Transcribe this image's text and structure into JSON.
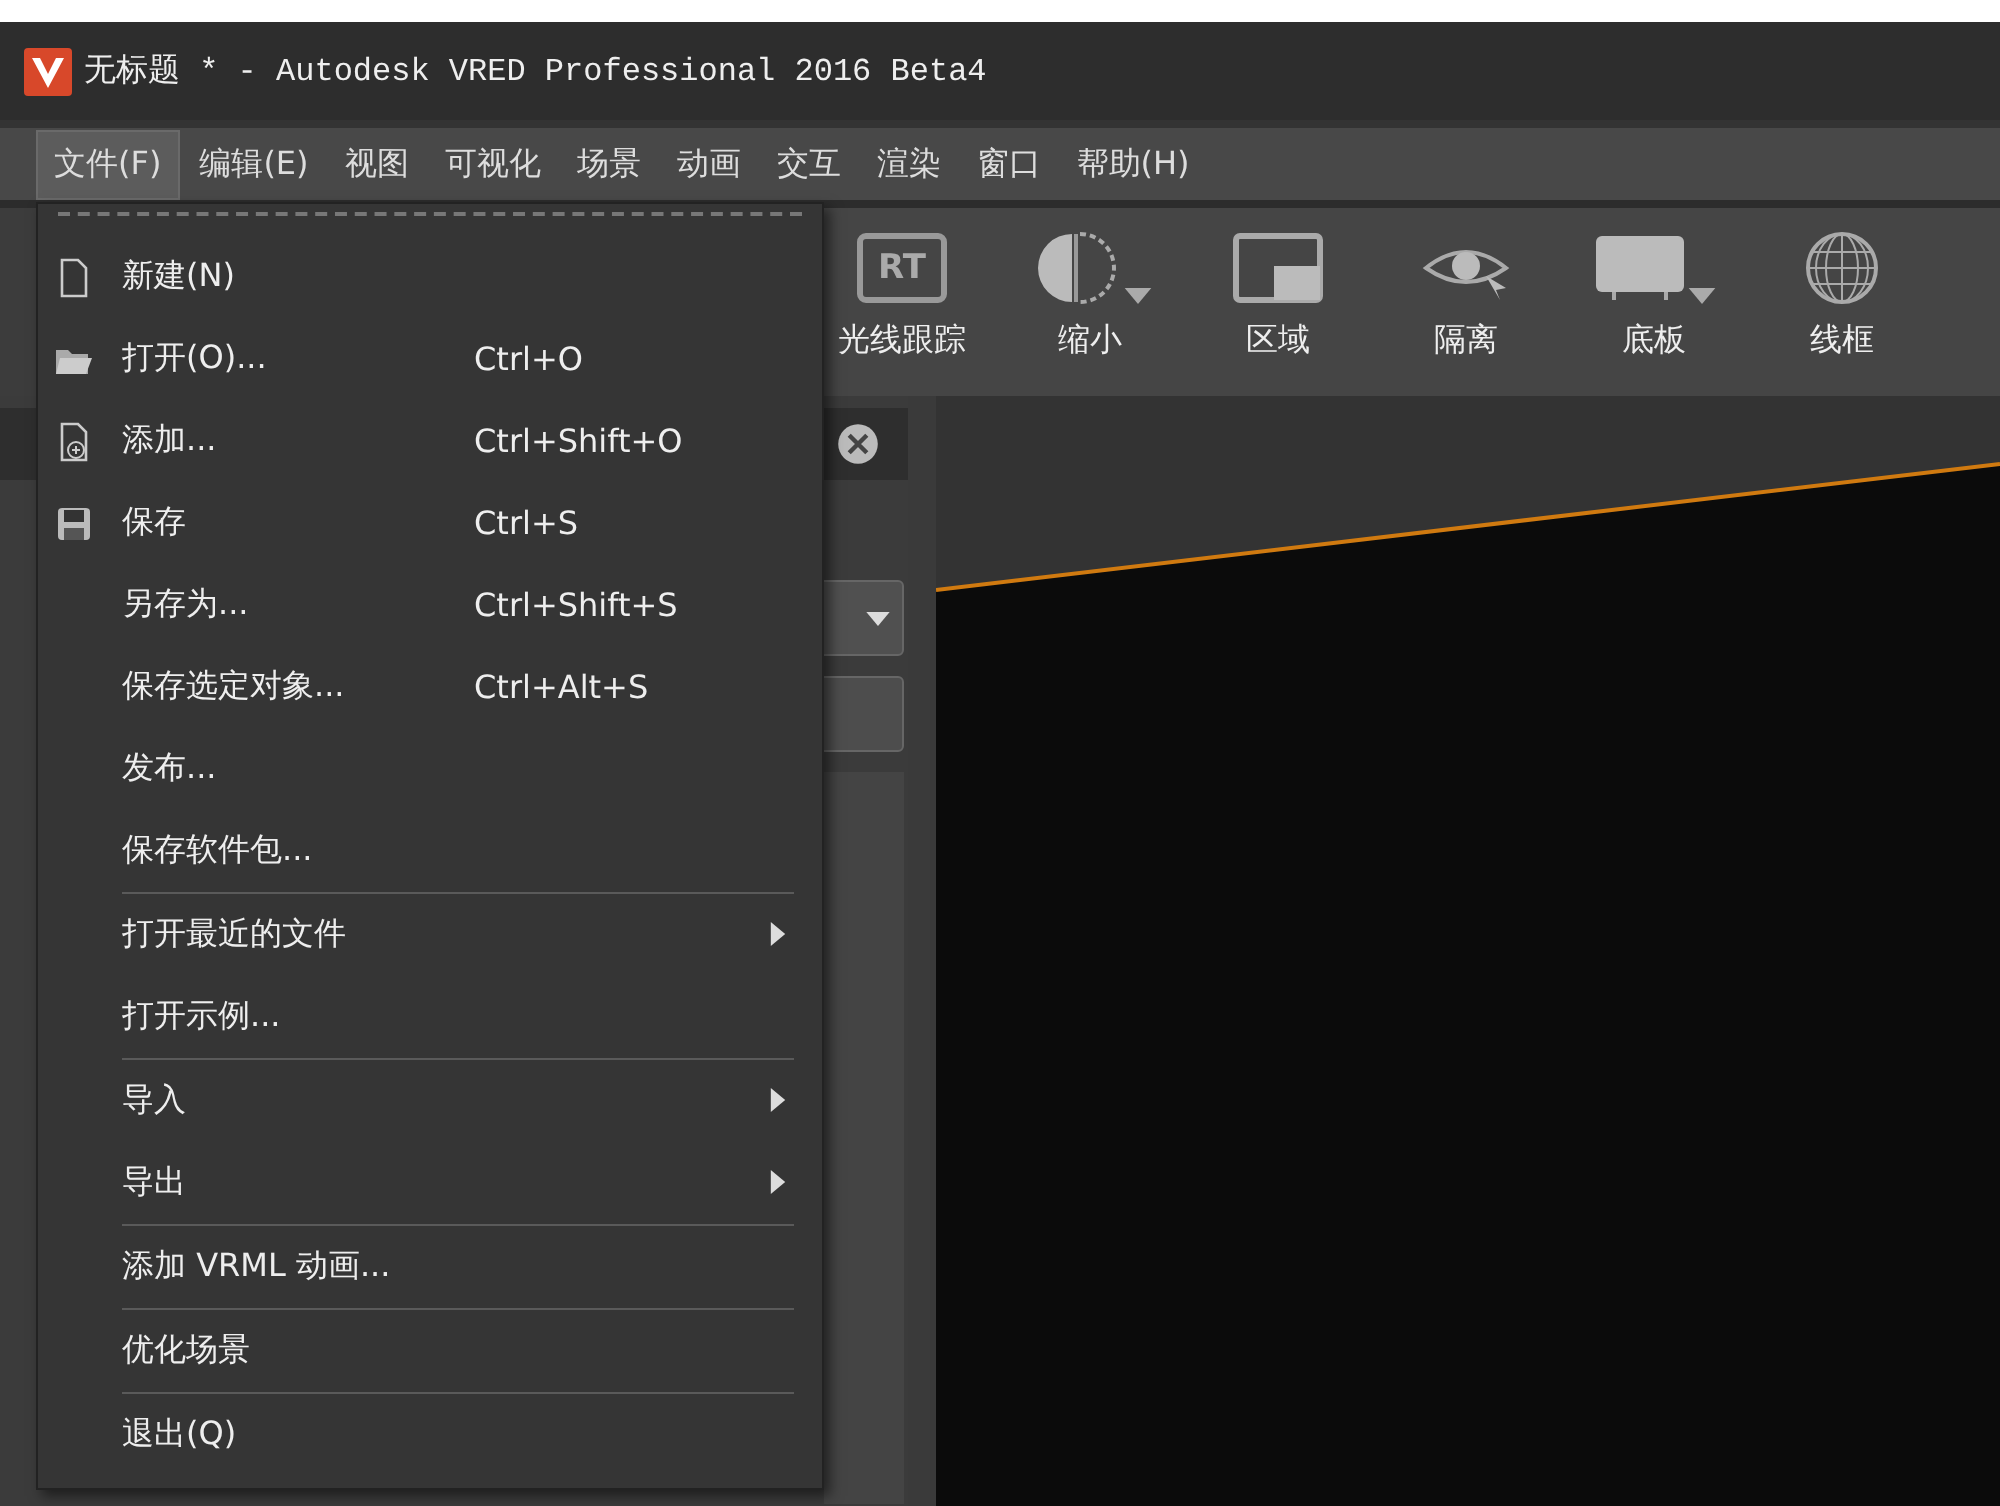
{
  "window": {
    "title": "无标题 * - Autodesk VRED Professional 2016 Beta4"
  },
  "menubar": [
    {
      "label": "文件(F)",
      "selected": true
    },
    {
      "label": "编辑(E)",
      "selected": false
    },
    {
      "label": "视图",
      "selected": false
    },
    {
      "label": "可视化",
      "selected": false
    },
    {
      "label": "场景",
      "selected": false
    },
    {
      "label": "动画",
      "selected": false
    },
    {
      "label": "交互",
      "selected": false
    },
    {
      "label": "渲染",
      "selected": false
    },
    {
      "label": "窗口",
      "selected": false
    },
    {
      "label": "帮助(H)",
      "selected": false
    }
  ],
  "toolbar": [
    {
      "kind": "rt",
      "icon_text": "RT",
      "label": "光线跟踪",
      "dropdown": false
    },
    {
      "kind": "half",
      "label": "缩小",
      "dropdown": true
    },
    {
      "kind": "region",
      "label": "区域",
      "dropdown": false
    },
    {
      "kind": "eye",
      "label": "隔离",
      "dropdown": false
    },
    {
      "kind": "plate",
      "label": "底板",
      "dropdown": true
    },
    {
      "kind": "globe",
      "label": "线框",
      "dropdown": false
    }
  ],
  "file_menu": {
    "groups": [
      [
        {
          "kind": "page",
          "label": "新建(N)",
          "submenu": false
        },
        {
          "kind": "folder",
          "label": "打开(O)...",
          "shortcut": "Ctrl+O",
          "submenu": false
        },
        {
          "kind": "page-add",
          "label": "添加...",
          "shortcut": "Ctrl+Shift+O",
          "submenu": false
        },
        {
          "kind": "disk",
          "label": "保存",
          "shortcut": "Ctrl+S",
          "submenu": false
        },
        {
          "kind": "plain",
          "label": "另存为...",
          "shortcut": "Ctrl+Shift+S",
          "submenu": false
        },
        {
          "kind": "plain",
          "label": "保存选定对象...",
          "shortcut": "Ctrl+Alt+S",
          "submenu": false
        },
        {
          "kind": "plain",
          "label": "发布...",
          "submenu": false
        },
        {
          "kind": "plain",
          "label": "保存软件包...",
          "submenu": false
        }
      ],
      [
        {
          "kind": "plain",
          "label": "打开最近的文件",
          "submenu": true
        },
        {
          "kind": "plain",
          "label": "打开示例...",
          "submenu": false
        }
      ],
      [
        {
          "kind": "plain",
          "label": "导入",
          "submenu": true
        },
        {
          "kind": "plain",
          "label": "导出",
          "submenu": true
        }
      ],
      [
        {
          "kind": "plain",
          "label": "添加 VRML 动画...",
          "submenu": false
        }
      ],
      [
        {
          "kind": "plain",
          "label": "优化场景",
          "submenu": false
        }
      ],
      [
        {
          "kind": "plain",
          "label": "退出(Q)",
          "submenu": false
        }
      ]
    ]
  }
}
